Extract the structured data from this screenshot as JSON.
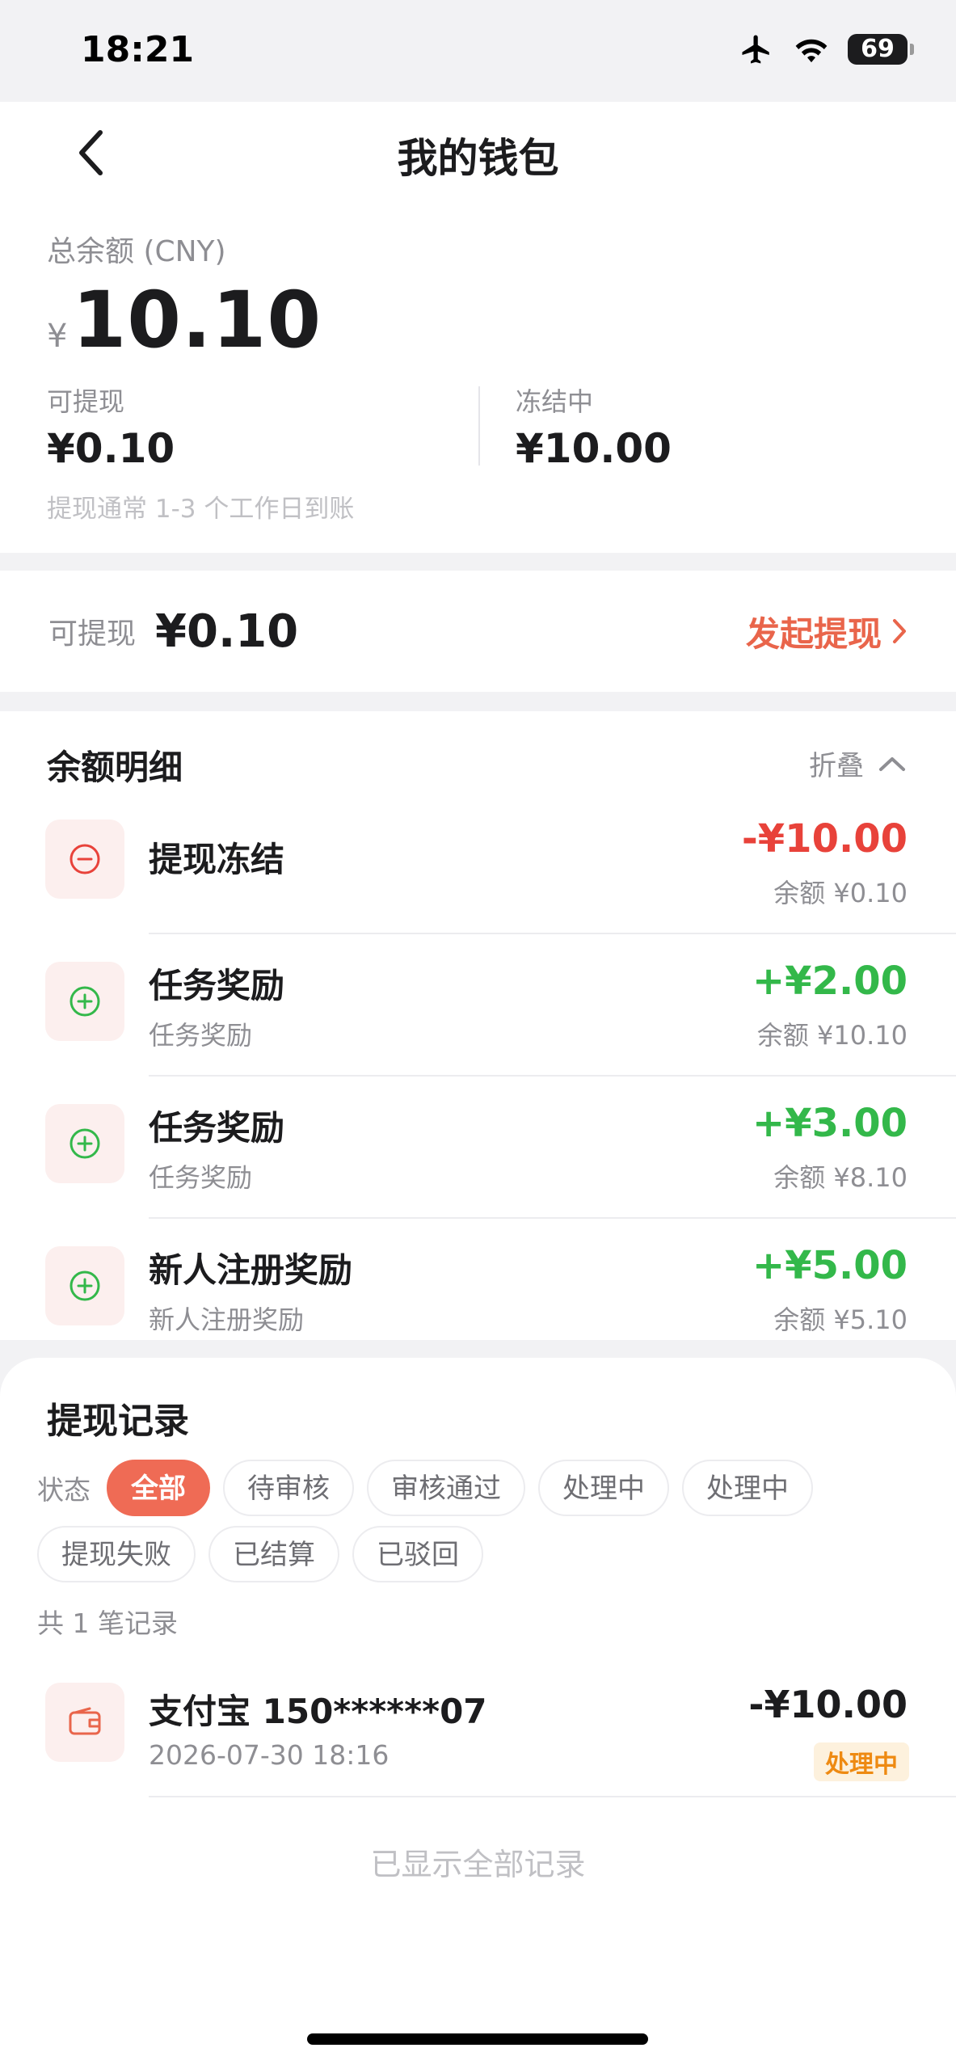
{
  "status_bar": {
    "time": "18:21",
    "battery": "69"
  },
  "header": {
    "title": "我的钱包"
  },
  "balance": {
    "label": "总余额 (CNY)",
    "currency": "¥",
    "amount": "10.10",
    "withdrawable_label": "可提现",
    "withdrawable_value": "¥0.10",
    "frozen_label": "冻结中",
    "frozen_value": "¥10.00",
    "note": "提现通常 1-3 个工作日到账"
  },
  "withdraw_bar": {
    "label": "可提现",
    "value": "¥0.10",
    "action": "发起提现"
  },
  "details": {
    "title": "余额明细",
    "collapse_label": "折叠",
    "items": [
      {
        "title": "提现冻结",
        "subtitle": "",
        "amount": "-¥10.00",
        "balance": "余额 ¥0.10",
        "type": "minus"
      },
      {
        "title": "任务奖励",
        "subtitle": "任务奖励",
        "amount": "+¥2.00",
        "balance": "余额 ¥10.10",
        "type": "plus"
      },
      {
        "title": "任务奖励",
        "subtitle": "任务奖励",
        "amount": "+¥3.00",
        "balance": "余额 ¥8.10",
        "type": "plus"
      },
      {
        "title": "新人注册奖励",
        "subtitle": "新人注册奖励",
        "amount": "+¥5.00",
        "balance": "余额 ¥5.10",
        "type": "plus"
      }
    ]
  },
  "records": {
    "title": "提现记录",
    "filter_label": "状态",
    "filters": [
      "全部",
      "待审核",
      "审核通过",
      "处理中",
      "处理中",
      "提现失败",
      "已结算",
      "已驳回"
    ],
    "active_filter": "全部",
    "count_text": "共 1 笔记录",
    "items": [
      {
        "title": "支付宝 150******07",
        "time": "2026-07-30 18:16",
        "amount": "-¥10.00",
        "status": "处理中"
      }
    ],
    "footer": "已显示全部记录"
  },
  "colors": {
    "accent": "#ef6b55",
    "negative": "#e8423a",
    "positive": "#33b84a",
    "pending_badge": "#ee8a12"
  },
  "icons": {
    "back": "chevron-left-icon",
    "airplane": "airplane-icon",
    "wifi": "wifi-icon",
    "battery": "battery-icon",
    "withdraw_arrow": "chevron-right-icon",
    "collapse": "chevron-up-icon",
    "minus": "minus-circle-icon",
    "plus": "plus-circle-icon",
    "wallet": "wallet-icon"
  }
}
